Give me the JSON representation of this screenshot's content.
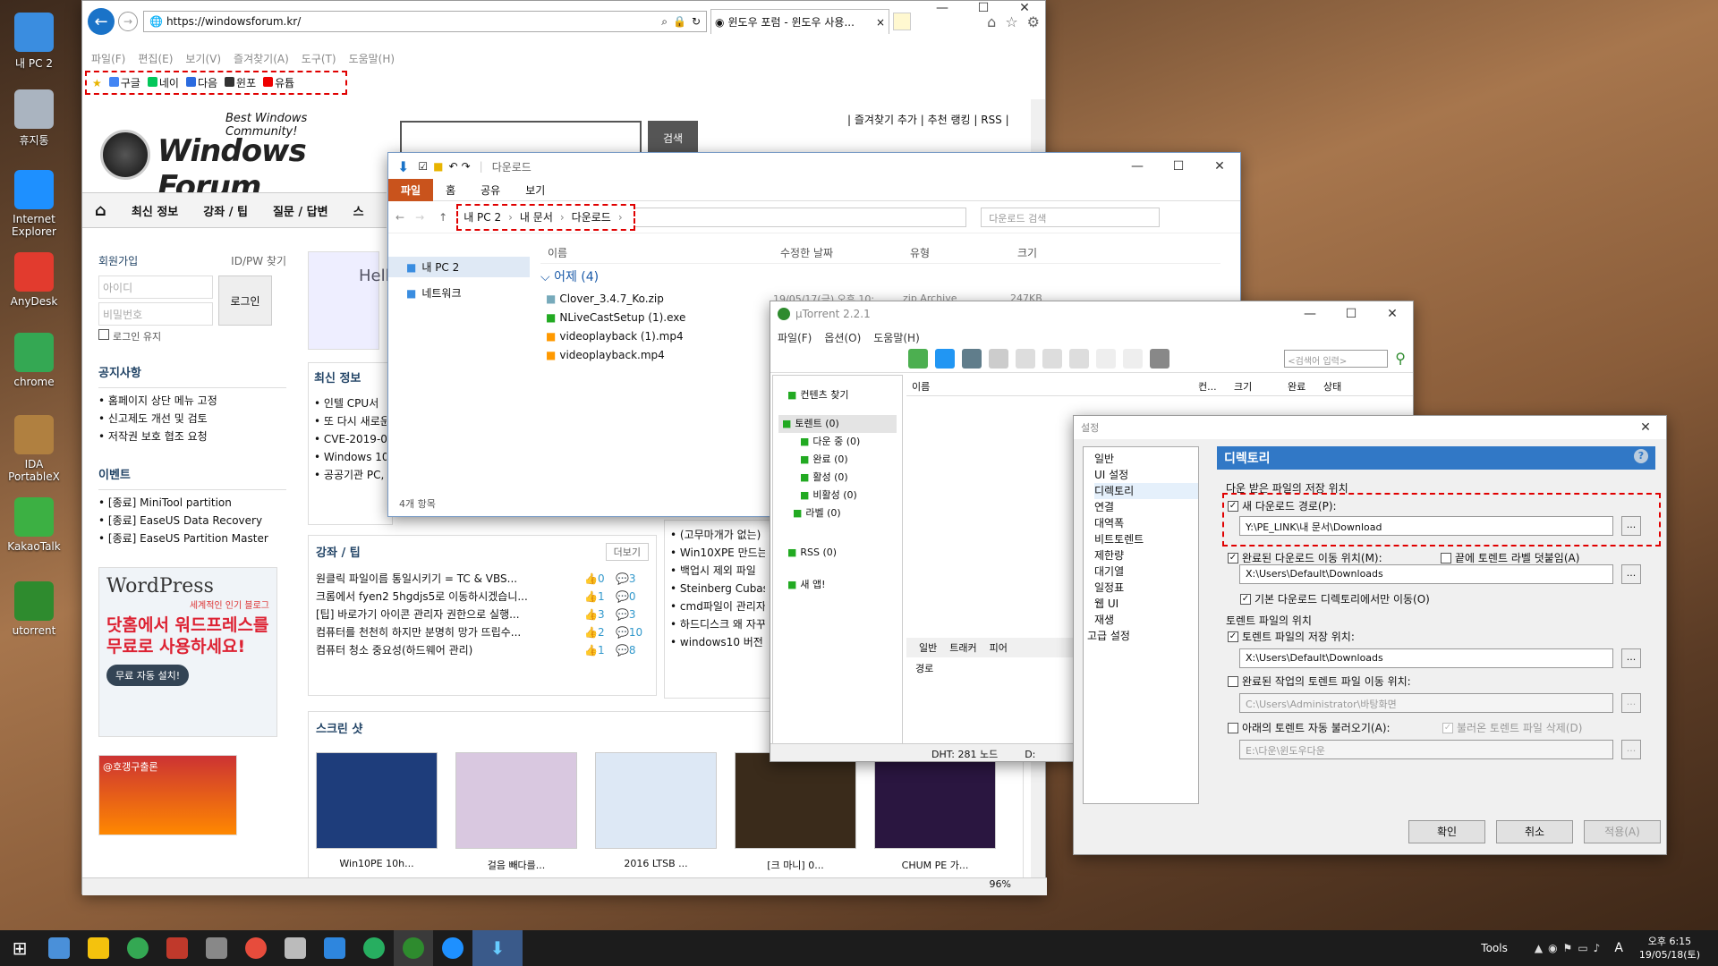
{
  "desktop": {
    "icons": [
      {
        "label": "내 PC 2",
        "color": "#3a8de0"
      },
      {
        "label": "휴지통",
        "color": "#aab4c0"
      },
      {
        "label": "Internet Explorer",
        "color": "#1e90ff"
      },
      {
        "label": "AnyDesk",
        "color": "#e23b2e"
      },
      {
        "label": "chrome",
        "color": "#34a853"
      },
      {
        "label": "IDA PortableX",
        "color": "#b08040"
      },
      {
        "label": "KakaoTalk",
        "color": "#3cb043"
      },
      {
        "label": "utorrent",
        "color": "#2e8b2e"
      }
    ]
  },
  "ie": {
    "url": "https://windowsforum.kr/",
    "tab_title": "윈도우 포럼 - 윈도우 사용...",
    "menu": [
      "파일(F)",
      "편집(E)",
      "보기(V)",
      "즐겨찾기(A)",
      "도구(T)",
      "도움말(H)"
    ],
    "favorites": [
      "구글",
      "네이",
      "다음",
      "윈포",
      "유튭"
    ],
    "zoom": "96%",
    "site": {
      "tagline": "Best Windows Community!",
      "logo": "Windows Forum",
      "search_btn": "검색",
      "top_links": "| 즐겨찾기 추가 | 추천 랭킹 | RSS |",
      "nav": [
        "최신 정보",
        "강좌 / 팁",
        "질문 / 답변",
        "스"
      ],
      "signup": "회원가입",
      "find": "ID/PW 찾기",
      "id_ph": "아이디",
      "pw_ph": "비밀번호",
      "login": "로그인",
      "keep": "로그인 유지",
      "notice_title": "공지사항",
      "notices": [
        "홈페이지 상단 메뉴 고정",
        "신고제도 개선 및 검토",
        "저작권 보호 협조 요청"
      ],
      "event_title": "이벤트",
      "events": [
        "[종료] MiniTool partition",
        "[종료] EaseUS Data Recovery",
        "[종료] EaseUS Partition Master"
      ],
      "latest_title": "최신 정보",
      "latest": [
        "인텔 CPU서",
        "또 다시 새로운",
        "CVE-2019-070",
        "Windows 10,",
        "공공기관 PC,"
      ],
      "tips_title": "강좌 / 팁",
      "more": "더보기",
      "tips": [
        {
          "t": "원클릭 파일이름 통일시키기 = TC & VBS...",
          "l": "0",
          "c": "3"
        },
        {
          "t": "크롬에서 fyen2 5hgdjs5로 이동하시겠습니...",
          "l": "1",
          "c": "0"
        },
        {
          "t": "[팁] 바로가기 아이콘 관리자 권한으로 실행...",
          "l": "3",
          "c": "3"
        },
        {
          "t": "컴퓨터를 천천히 하지만 분명히 망가 뜨립수...",
          "l": "2",
          "c": "10"
        },
        {
          "t": "컴퓨터 청소 중요성(하드웨어 관리)",
          "l": "1",
          "c": "8"
        }
      ],
      "qa": [
        "(고무마개가 없는)",
        "Win10XPE 만드는법",
        "백업시 제외 파일",
        "Steinberg Cubase",
        "cmd파일이 관리자",
        "하드디스크 왜 자꾸",
        "windows10 버전"
      ],
      "wp_logo": "WordPress",
      "wp_sub": "세계적인 인기 블로그",
      "wp_ad": "닷홈에서 워드프레스를 무료로 사용하세요!",
      "wp_btn": "무료 자동 설치!",
      "ad2": "@호갱구출론",
      "screens_title": "스크린 샷",
      "screens": [
        "Win10PE 10h...",
        "걸음 빼다를...",
        "2016 LTSB ...",
        "[크 마니] 0...",
        "CHUM PE 가..."
      ]
    }
  },
  "explorer": {
    "title": "다운로드",
    "tabs": [
      "파일",
      "홈",
      "공유",
      "보기"
    ],
    "breadcrumb": [
      "내 PC 2",
      "내 문서",
      "다운로드"
    ],
    "search_ph": "다운로드 검색",
    "nav": [
      "내 PC 2",
      "네트워크"
    ],
    "cols": [
      "이름",
      "수정한 날짜",
      "유형",
      "크기"
    ],
    "group": "어제 (4)",
    "files": [
      {
        "name": "Clover_3.4.7_Ko.zip",
        "date": "19/05/17(금) 오후 10:...",
        "type": "zip Archive",
        "size": "247KB"
      },
      {
        "name": "NLiveCastSetup (1).exe",
        "date": "",
        "type": "",
        "size": ""
      },
      {
        "name": "videoplayback (1).mp4",
        "date": "",
        "type": "",
        "size": ""
      },
      {
        "name": "videoplayback.mp4",
        "date": "",
        "type": "",
        "size": ""
      }
    ],
    "status": "4개 항목"
  },
  "utorrent": {
    "title": "µTorrent 2.2.1",
    "menu": [
      "파일(F)",
      "옵션(O)",
      "도움말(H)"
    ],
    "search_ph": "<검색어 입력>",
    "side": [
      "컨텐츠 찾기",
      "토렌트 (0)",
      "다운 중 (0)",
      "완료 (0)",
      "활성 (0)",
      "비활성 (0)",
      "라벨 (0)",
      "RSS (0)",
      "새 앱!"
    ],
    "cols": [
      "이름",
      "컨...",
      "크기",
      "완료",
      "상태"
    ],
    "tabs": [
      "일반",
      "트래커",
      "피어"
    ],
    "path_label": "경로",
    "status": "DHT: 281 노드",
    "status2": "D:"
  },
  "settings": {
    "title": "설정",
    "tree": [
      "일반",
      "UI 설정",
      "디렉토리",
      "연결",
      "대역폭",
      "비트토렌트",
      "제한량",
      "대기열",
      "일정표",
      "웹 UI",
      "재생",
      "고급 설정"
    ],
    "header": "디렉토리",
    "group1": "다운 받은 파일의 저장 위치",
    "new_dl_label": "새 다운로드 경로(P):",
    "new_dl_path": "Y:\\PE_LINK\\내 문서\\Download",
    "move_done_label": "완료된 다운로드 이동 위치(M):",
    "append_label": "끝에 토렌트 라벨 덧붙임(A)",
    "move_done_path": "X:\\Users\\Default\\Downloads",
    "only_default": "기본 다운로드 디렉토리에서만 이동(O)",
    "group2": "토렌트 파일의 위치",
    "torrent_store_label": "토렌트 파일의 저장 위치:",
    "torrent_store_path": "X:\\Users\\Default\\Downloads",
    "torrent_move_label": "완료된 작업의 토렌트 파일 이동 위치:",
    "torrent_move_path": "C:\\Users\\Administrator\\바탕화면",
    "autoload_label": "아래의 토렌트 자동 불러오기(A):",
    "delete_loaded": "불러온 토렌트 파일 삭제(D)",
    "autoload_path": "E:\\다운\\윈도우다운",
    "ok": "확인",
    "cancel": "취소",
    "apply": "적용(A)"
  },
  "taskbar": {
    "tools": "Tools",
    "ime": "A",
    "time": "오후 6:15",
    "date": "19/05/18(토)"
  }
}
